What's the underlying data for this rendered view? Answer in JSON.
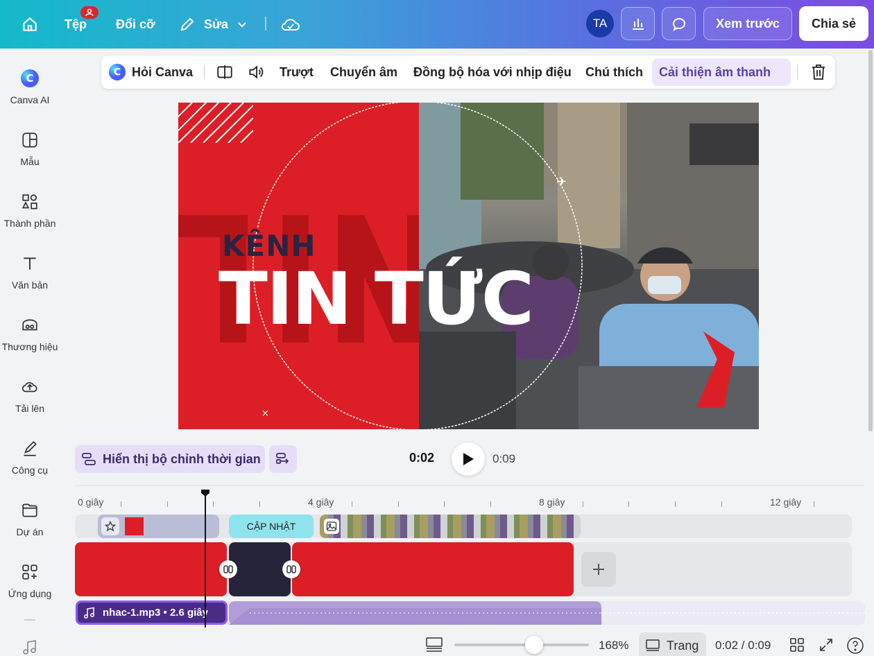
{
  "topbar": {
    "file_label": "Tệp",
    "resize_label": "Đổi cỡ",
    "edit_label": "Sửa",
    "avatar_initials": "TA",
    "preview_label": "Xem trước",
    "share_label": "Chia sẻ",
    "colors": {
      "gradient_start": "#14b9c9",
      "gradient_end": "#7e4be2",
      "badge": "#d7262e"
    }
  },
  "sidebar": {
    "items": [
      {
        "label": "Canva AI",
        "icon": "canva-ai-icon"
      },
      {
        "label": "Mẫu",
        "icon": "template-icon"
      },
      {
        "label": "Thành phần",
        "icon": "elements-icon"
      },
      {
        "label": "Văn bản",
        "icon": "text-icon"
      },
      {
        "label": "Thương hiệu",
        "icon": "brand-icon"
      },
      {
        "label": "Tải lên",
        "icon": "upload-icon"
      },
      {
        "label": "Công cụ",
        "icon": "tools-icon"
      },
      {
        "label": "Dự án",
        "icon": "folder-icon"
      },
      {
        "label": "Ứng dụng",
        "icon": "apps-icon"
      }
    ]
  },
  "context_toolbar": {
    "ask_canva": "Hỏi Canva",
    "slide": "Trượt",
    "transcribe": "Chuyển âm",
    "sync_beat": "Đồng bộ hóa với nhịp điệu",
    "captions": "Chú thích",
    "enhance_audio": "Cải thiện âm thanh"
  },
  "design": {
    "title_small": "KÊNH",
    "title_big": "TIN TỨC",
    "colors": {
      "red": "#dc1f26",
      "dark": "#2a2440"
    }
  },
  "playback": {
    "show_timing": "Hiển thị bộ chỉnh thời gian",
    "current_time": "0:02",
    "total_time": "0:09"
  },
  "timeline": {
    "ruler_labels": [
      "0 giây",
      "4 giây",
      "8 giây",
      "12 giây"
    ],
    "update_clip_label": "CẬP NHẬT",
    "audio_label": "nhac-1.mp3 • 2.6 giây"
  },
  "bottombar": {
    "zoom_percent": "168%",
    "zoom_level": 0.58,
    "page_label": "Trang",
    "time_readout": "0:02 / 0:09"
  }
}
